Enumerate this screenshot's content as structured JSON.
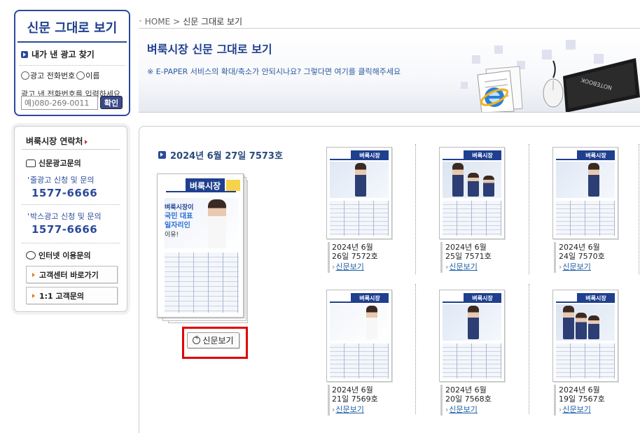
{
  "search": {
    "title": "신문 그대로 보기",
    "subtitle": "내가 낸 광고 찾기",
    "radio1": "광고 전화번호",
    "radio2": "이름",
    "hint": "광고 낸 전화번호를 입력하세요",
    "placeholder": "예)080-269-0011",
    "button": "확인"
  },
  "contact": {
    "title": "벼룩시장 연락처",
    "ad_section": "신문광고문의",
    "line_ad_label": "줄광고 신청 및 문의",
    "line_ad_phone": "1577-6666",
    "box_ad_label": "박스광고 신청 및 문의",
    "box_ad_phone": "1577-6666",
    "internet_section": "인터넷 이용문의",
    "btn_center": "고객센터 바로가기",
    "btn_inquiry": "1:1 고객문의"
  },
  "breadcrumb": {
    "home": "HOME",
    "sep": ">",
    "current": "신문 그대로 보기"
  },
  "banner": {
    "title": "벼룩시장 신문 그대로 보기",
    "note": "※ E-PAPER 서비스의 확대/축소가 안되시나요? 그렇다면 여기를 클릭해주세요",
    "laptop_text": "NOTEBOOK"
  },
  "current_issue": {
    "label": "2024년 6월 27일 7573호",
    "logo": "벼룩시장",
    "headline1": "벼룩시장이",
    "headline2": "국민 대표",
    "headline3": "일자리인",
    "headline4": "이유!",
    "view_button": "신문보기"
  },
  "issues": [
    {
      "date1": "2024년 6월",
      "date2": "26일 7572호",
      "link": "신문보기",
      "logo": "벼룩시장"
    },
    {
      "date1": "2024년 6월",
      "date2": "25일 7571호",
      "link": "신문보기",
      "logo": "벼룩시장"
    },
    {
      "date1": "2024년 6월",
      "date2": "24일 7570호",
      "link": "신문보기",
      "logo": "벼룩시장"
    },
    {
      "date1": "2024년 6월",
      "date2": "21일 7569호",
      "link": "신문보기",
      "logo": "벼룩시장"
    },
    {
      "date1": "2024년 6월",
      "date2": "20일 7568호",
      "link": "신문보기",
      "logo": "벼룩시장"
    },
    {
      "date1": "2024년 6월",
      "date2": "19일 7567호",
      "link": "신문보기",
      "logo": "벼룩시장"
    }
  ],
  "colors": {
    "brand": "#1f3f8f",
    "highlight": "#e10000",
    "link": "#1f5fa8"
  }
}
